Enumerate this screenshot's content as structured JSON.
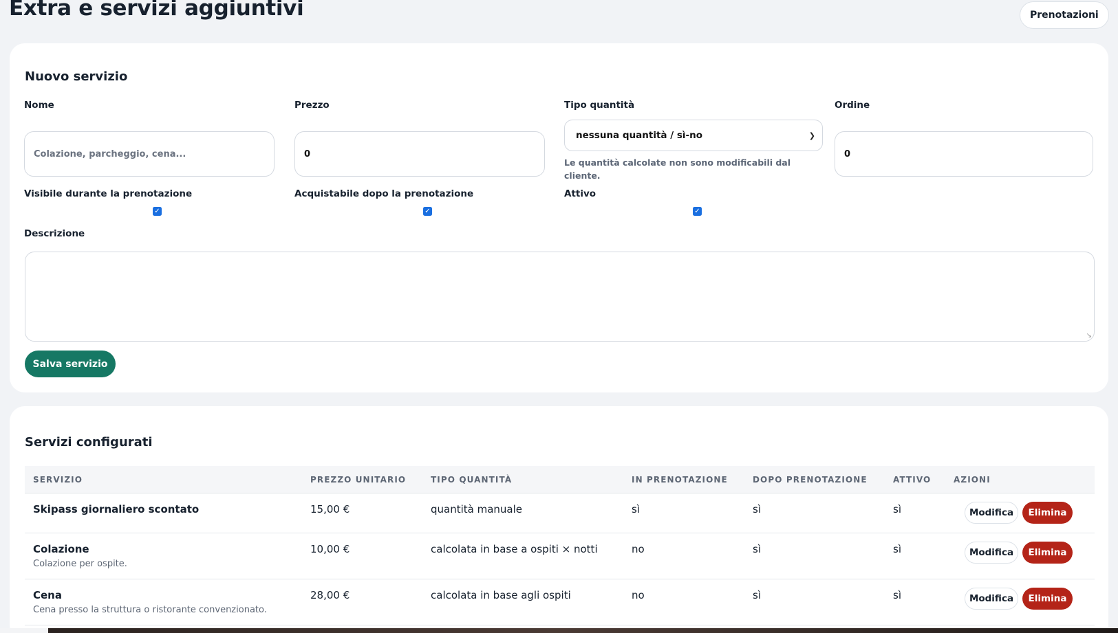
{
  "page": {
    "title": "Extra e servizi aggiuntivi",
    "top_button": "Prenotazioni"
  },
  "form": {
    "title": "Nuovo servizio",
    "name_label": "Nome",
    "name_placeholder": "Colazione, parcheggio, cena...",
    "price_label": "Prezzo",
    "price_value": "0",
    "qty_type_label": "Tipo quantità",
    "qty_type_value": "nessuna quantità / sì-no",
    "qty_hint": "Le quantità calcolate non sono modificabili dal cliente.",
    "order_label": "Ordine",
    "order_value": "0",
    "visible_label": "Visibile durante la prenotazione",
    "visible_checked": true,
    "after_label": "Acquistabile dopo la prenotazione",
    "after_checked": true,
    "active_label": "Attivo",
    "active_checked": true,
    "description_label": "Descrizione",
    "description_value": "",
    "save_label": "Salva servizio"
  },
  "list": {
    "title": "Servizi configurati",
    "columns": [
      "SERVIZIO",
      "PREZZO UNITARIO",
      "TIPO QUANTITÀ",
      "IN PRENOTAZIONE",
      "DOPO PRENOTAZIONE",
      "ATTIVO",
      "AZIONI"
    ],
    "rows": [
      {
        "name": "Skipass giornaliero scontato",
        "description": "",
        "price": "15,00 €",
        "qty_type": "quantità manuale",
        "in_booking": "sì",
        "after_booking": "sì",
        "active": "sì",
        "edit_label": "Modifica",
        "delete_label": "Elimina"
      },
      {
        "name": "Colazione",
        "description": "Colazione per ospite.",
        "price": "10,00 €",
        "qty_type": "calcolata in base a ospiti × notti",
        "in_booking": "no",
        "after_booking": "sì",
        "active": "sì",
        "edit_label": "Modifica",
        "delete_label": "Elimina"
      },
      {
        "name": "Cena",
        "description": "Cena presso la struttura o ristorante convenzionato.",
        "price": "28,00 €",
        "qty_type": "calcolata in base agli ospiti",
        "in_booking": "no",
        "after_booking": "sì",
        "active": "sì",
        "edit_label": "Modifica",
        "delete_label": "Elimina"
      }
    ]
  },
  "colors": {
    "primary": "#167864",
    "danger": "#b42418",
    "checkbox": "#1a6fe0"
  }
}
